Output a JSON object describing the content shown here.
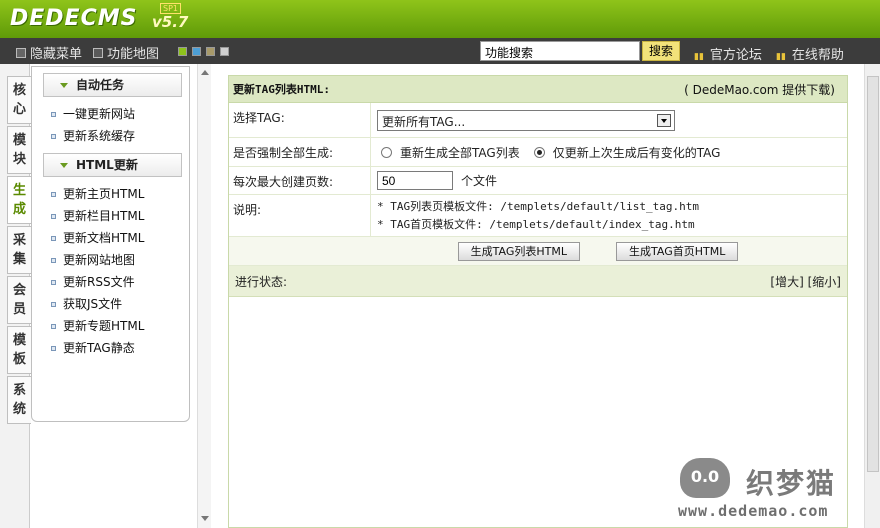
{
  "header": {
    "logo_text": "DEDECMS",
    "logo_version": "v5.7",
    "logo_sp": "SP1"
  },
  "toolbar": {
    "hide_menu_label": "隐藏菜单",
    "sitemap_label": "功能地图",
    "search_value": "功能搜索",
    "search_button": "搜索",
    "forum_link": "官方论坛",
    "help_link": "在线帮助",
    "theme_colors": [
      "#8ec21c",
      "#4d9fd6",
      "#a89a6a",
      "#d0d0d0"
    ]
  },
  "left_tabs": [
    {
      "label": "核\n心",
      "active": false
    },
    {
      "label": "模\n块",
      "active": false
    },
    {
      "label": "生\n成",
      "active": true
    },
    {
      "label": "采\n集",
      "active": false
    },
    {
      "label": "会\n员",
      "active": false
    },
    {
      "label": "模\n板",
      "active": false
    },
    {
      "label": "系\n统",
      "active": false
    }
  ],
  "sidemenu": {
    "groups": [
      {
        "title": "自动任务",
        "items": [
          "一键更新网站",
          "更新系统缓存"
        ]
      },
      {
        "title": "HTML更新",
        "items": [
          "更新主页HTML",
          "更新栏目HTML",
          "更新文档HTML",
          "更新网站地图",
          "更新RSS文件",
          "获取JS文件",
          "更新专题HTML",
          "更新TAG静态"
        ]
      }
    ]
  },
  "main": {
    "title": "更新TAG列表HTML:",
    "download_note": "( DedeMao.com 提供下载)",
    "select_tag_label": "选择TAG:",
    "select_tag_value": "更新所有TAG...",
    "force_label": "是否强制全部生成:",
    "force_options": [
      "重新生成全部TAG列表",
      "仅更新上次生成后有变化的TAG"
    ],
    "force_selected": 1,
    "max_pages_label": "每次最大创建页数:",
    "max_pages_value": "50",
    "max_pages_unit": "个文件",
    "desc_label": "说明:",
    "desc_lines": [
      "* TAG列表页模板文件: /templets/default/list_tag.htm",
      "* TAG首页模板文件: /templets/default/index_tag.htm"
    ],
    "btn_list": "生成TAG列表HTML",
    "btn_index": "生成TAG首页HTML",
    "status_label": "进行状态:",
    "enlarge": "[增大]",
    "shrink": "[缩小]"
  },
  "watermark": {
    "cat": "0.0",
    "name": "织梦猫",
    "url": "www.dedemao.com"
  }
}
